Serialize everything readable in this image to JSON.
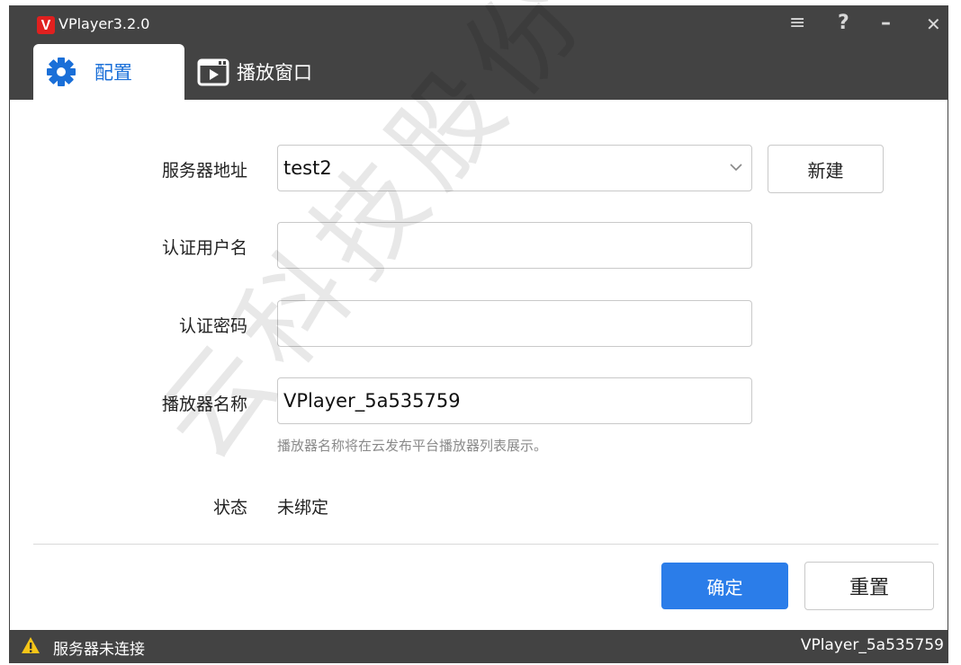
{
  "window": {
    "logo_letter": "V",
    "title": "VPlayer3.2.0",
    "controls": {
      "menu": "≡",
      "help": "?",
      "minimize": "–",
      "close": "✕"
    }
  },
  "tabs": [
    {
      "label": "配置",
      "icon": "gear-icon",
      "active": true
    },
    {
      "label": "播放窗口",
      "icon": "play-window-icon",
      "active": false
    }
  ],
  "form": {
    "server_address": {
      "label": "服务器地址",
      "value": "test2",
      "new_button": "新建"
    },
    "auth_username": {
      "label": "认证用户名",
      "value": ""
    },
    "auth_password": {
      "label": "认证密码",
      "value": ""
    },
    "player_name": {
      "label": "播放器名称",
      "value": "VPlayer_5a535759",
      "hint": "播放器名称将在云发布平台播放器列表展示。"
    },
    "status": {
      "label": "状态",
      "value": "未绑定"
    }
  },
  "actions": {
    "confirm": "确定",
    "reset": "重置"
  },
  "statusbar": {
    "message": "服务器未连接",
    "player_id": "VPlayer_5a535759"
  },
  "watermark": "云科技股份有限公",
  "colors": {
    "titlebar": "#434343",
    "primary": "#2b7de9",
    "active_tab": "#1a6fd8",
    "logo": "#e0201f",
    "warning": "#f5c518"
  }
}
